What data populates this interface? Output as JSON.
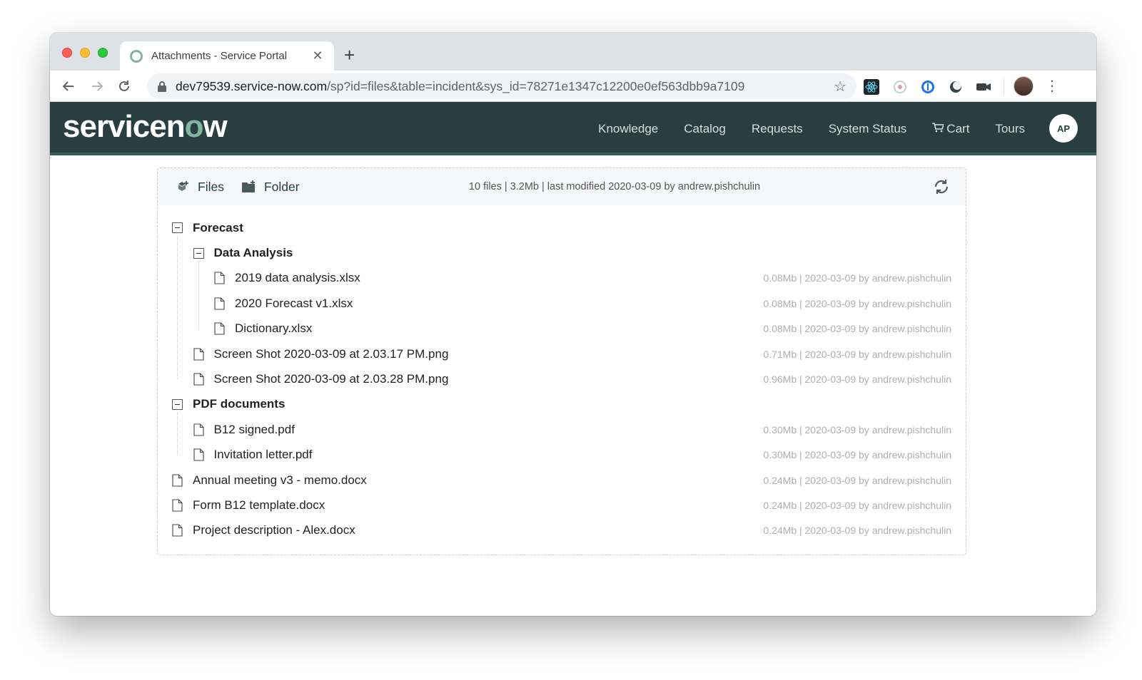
{
  "browser": {
    "tab_title": "Attachments - Service Portal",
    "url_host": "dev79539.service-now.com",
    "url_path": "/sp?id=files&table=incident&sys_id=78271e1347c12200e0ef563dbb9a7109"
  },
  "header": {
    "logo_text_a": "servicen",
    "logo_text_o": "o",
    "logo_text_b": "w",
    "nav": [
      "Knowledge",
      "Catalog",
      "Requests",
      "System Status",
      "Cart",
      "Tours"
    ],
    "avatar_initials": "AP"
  },
  "panel": {
    "files_label": "Files",
    "folder_label": "Folder",
    "summary": "10 files | 3.2Mb | last modified 2020-03-09 by andrew.pishchulin"
  },
  "tree": [
    {
      "type": "folder",
      "level": 0,
      "name": "Forecast",
      "meta": ""
    },
    {
      "type": "folder",
      "level": 1,
      "name": "Data Analysis",
      "meta": ""
    },
    {
      "type": "file",
      "level": 2,
      "name": "2019 data analysis.xlsx",
      "meta": "0.08Mb | 2020-03-09 by andrew.pishchulin"
    },
    {
      "type": "file",
      "level": 2,
      "name": "2020 Forecast v1.xlsx",
      "meta": "0.08Mb | 2020-03-09 by andrew.pishchulin"
    },
    {
      "type": "file",
      "level": 2,
      "name": "Dictionary.xlsx",
      "meta": "0.08Mb | 2020-03-09 by andrew.pishchulin"
    },
    {
      "type": "file",
      "level": 1,
      "name": "Screen Shot 2020-03-09 at 2.03.17 PM.png",
      "meta": "0.71Mb | 2020-03-09 by andrew.pishchulin"
    },
    {
      "type": "file",
      "level": 1,
      "name": "Screen Shot 2020-03-09 at 2.03.28 PM.png",
      "meta": "0.96Mb | 2020-03-09 by andrew.pishchulin"
    },
    {
      "type": "folder",
      "level": 0,
      "name": "PDF documents",
      "meta": ""
    },
    {
      "type": "file",
      "level": 1,
      "name": "B12 signed.pdf",
      "meta": "0.30Mb | 2020-03-09 by andrew.pishchulin"
    },
    {
      "type": "file",
      "level": 1,
      "name": "Invitation letter.pdf",
      "meta": "0.30Mb | 2020-03-09 by andrew.pishchulin"
    },
    {
      "type": "file",
      "level": 0,
      "name": "Annual meeting v3 - memo.docx",
      "meta": "0.24Mb | 2020-03-09 by andrew.pishchulin"
    },
    {
      "type": "file",
      "level": 0,
      "name": "Form B12 template.docx",
      "meta": "0.24Mb | 2020-03-09 by andrew.pishchulin"
    },
    {
      "type": "file",
      "level": 0,
      "name": "Project description - Alex.docx",
      "meta": "0.24Mb | 2020-03-09 by andrew.pishchulin"
    }
  ]
}
